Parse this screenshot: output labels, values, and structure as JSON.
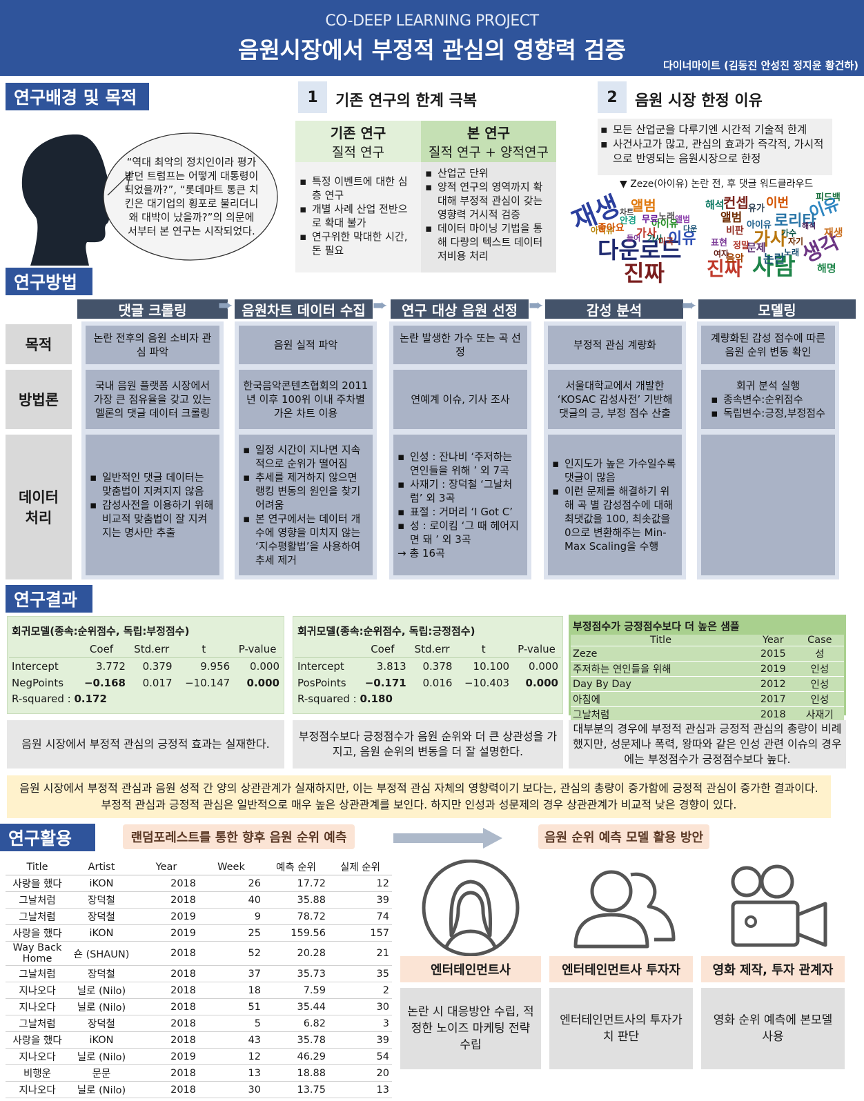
{
  "header": {
    "subtitle": "CO-DEEP LEARNING PROJECT",
    "title": "음원시장에서 부정적 관심의 영향력 검증",
    "authors": "다이너마이트 (김동진 안성진 정지윤 황건하)"
  },
  "background": {
    "section": "연구배경 및 목적",
    "quote": "“역대 최악의 정치인이라 평가받던 트럼프는 어떻게 대통령이 되었을까?”, “롯데마트 통큰 치킨은 대기업의 횡포로 불리더니 왜 대박이 났을까?”의 의문에서부터 본 연구는 시작되었다."
  },
  "limit": {
    "num": "1",
    "title": "기존 연구의 한계 극복",
    "prev_head": "기존 연구",
    "prev_sub": "질적 연구",
    "this_head": "본 연구",
    "this_sub": "질적 연구 + 양적연구",
    "prev_items": [
      "특정 이벤트에 대한 심층 연구",
      "개별 사례 산업 전반으로 확대 불가",
      "연구위한 막대한 시간, 돈 필요"
    ],
    "this_items": [
      "산업군 단위",
      "양적 연구의 영역까지 확대해 부정적 관심이 갖는 영향력 거시적 검증",
      "데이터 마이닝 기법을 통해 다량의 텍스트 데이터 저비용 처리"
    ]
  },
  "reason": {
    "num": "2",
    "title": "음원 시장 한정 이유",
    "items": [
      "모든 산업군을 다루기엔 시간적 기술적 한계",
      "사건사고가 많고, 관심의 효과가 즉각적, 가시적으로 반영되는 음원시장으로 한정"
    ],
    "caption": "▼ Zeze(아이유) 논란 전, 후 댓글 워드클라우드"
  },
  "wordcloud": {
    "before": [
      "재생",
      "다운로드",
      "진짜",
      "앨범",
      "이유",
      "아이유",
      "가사",
      "노래",
      "무료",
      "앨범",
      "안경",
      "아이유",
      "좋아요",
      "가사",
      "미국",
      "차트",
      "다운",
      "들어"
    ],
    "after": [
      "사람",
      "진짜",
      "생각",
      "가사",
      "이유",
      "로리타",
      "컨셉",
      "이번",
      "해석",
      "앨범",
      "재생",
      "아이유",
      "논란",
      "해명",
      "표현",
      "비판",
      "정말",
      "가수",
      "음악",
      "문제",
      "피드백",
      "유가",
      "자기",
      "노래",
      "해석",
      "여자"
    ]
  },
  "method": {
    "section": "연구방법",
    "steps": [
      "댓글 크롤링",
      "음원차트 데이터 수집",
      "연구 대상 음원 선정",
      "감성 분석",
      "모델링"
    ],
    "rows": [
      "목적",
      "방법론",
      "데이터\n처리"
    ],
    "purpose": [
      "논란 전후의 음원 소비자 관심 파악",
      "음원 실적 파악",
      "논란 발생한 가수 또는 곡 선정",
      "부정적 관심 계량화",
      "계량화된 감성 점수에 따른 음원 순위 변동 확인"
    ],
    "methodology": [
      "국내 음원 플랫폼 시장에서 가장 큰 점유율을 갖고 있는 멜론의 댓글 데이터 크롤링",
      "한국음악콘텐츠협회의 2011년 이후 100위 이내 주차별 가온 차트 이용",
      "연예계 이슈, 기사 조사",
      "서울대학교에서 개발한 ‘KOSAC 감성사전’ 기반해 댓글의 긍, 부정 점수 산출"
    ],
    "model_method_head": "회귀 분석 실행",
    "model_method_items": [
      "종속변수:순위점수",
      "독립변수:긍정,부정점수"
    ],
    "data1": [
      "일반적인 댓글 데이터는 맞춤법이 지켜지지 않음",
      "감성사전을 이용하기 위해  비교적 맞춤법이 잘 지켜지는 명사만 추출"
    ],
    "data2": [
      "일정 시간이 지나면 지속적으로 순위가 떨어짐",
      "추세를 제거하지 않으면 랭킹 변동의 원인을 찾기 어려움",
      "본 연구에서는 데이터 개수에 영향을 미치지 않는 ‘지수평활법’을 사용하여 추세 제거"
    ],
    "data3": [
      "인성 : 잔나비 ‘주저하는 연인들을 위해 ’  외 7곡",
      "사재기 : 장덕철 ‘그날처럼’ 외 3곡",
      "표절 : 거머리 ‘I Got C’",
      "성 : 로이킴 ‘그 때 헤어지면 돼 ’  외 3곡"
    ],
    "data3_total": "→ 총 16곡",
    "data4": [
      "인지도가 높은 가수일수록 댓글이 많음",
      "이런 문제를 해결하기 위해 곡 별 감성점수에 대해 최댓값을 100, 최솟값을 0으로 변환해주는 Min-Max Scaling을 수행"
    ]
  },
  "results": {
    "section": "연구결과",
    "reg1": {
      "title": "회귀모델(종속:순위점수, 독립:부정점수)",
      "cols": [
        "",
        "Coef",
        "Std.err",
        "t",
        "P-value"
      ],
      "rows": [
        [
          "Intercept",
          "3.772",
          "0.379",
          "9.956",
          "0.000"
        ],
        [
          "NegPoints",
          "−0.168",
          "0.017",
          "−10.147",
          "0.000"
        ]
      ],
      "r2_label": "R-squared : ",
      "r2": "0.172"
    },
    "reg2": {
      "title": "회귀모델(종속:순위점수, 독립:긍정점수)",
      "cols": [
        "",
        "Coef",
        "Std.err",
        "t",
        "P-value"
      ],
      "rows": [
        [
          "Intercept",
          "3.813",
          "0.378",
          "10.100",
          "0.000"
        ],
        [
          "PosPoints",
          "−0.171",
          "0.016",
          "−10.403",
          "0.000"
        ]
      ],
      "r2_label": "R-squared : ",
      "r2": "0.180"
    },
    "sample": {
      "title": "부정점수가 긍정점수보다 더 높은 샘플",
      "cols": [
        "Title",
        "Year",
        "Case"
      ],
      "rows": [
        [
          "Zeze",
          "2015",
          "성"
        ],
        [
          "주저하는 연인들을 위해",
          "2019",
          "인성"
        ],
        [
          "Day By Day",
          "2012",
          "인성"
        ],
        [
          "아침에",
          "2017",
          "인성"
        ],
        [
          "그날처럼",
          "2018",
          "사재기"
        ]
      ]
    },
    "note1": "음원 시장에서 부정적 관심의 긍정적 효과는 실재한다.",
    "note2": "부정점수보다 긍정점수가 음원 순위와 더 큰 상관성을 가지고, 음원 순위의 변동을 더 잘 설명한다.",
    "note3": "대부분의 경우에 부정적 관심과 긍정적 관심의 총량이 비례했지만, 성문제나 폭력, 왕따와 같은 인성 관련 이슈의 경우에는 부정점수가 긍정점수보다 높다.",
    "conclusion": "음원 시장에서 부정적 관심과 음원 성적 간 양의 상관관계가 실재하지만, 이는 부정적 관심 자체의 영향력이기 보다는, 관심의 총량이 증가함에 긍정적 관심이 증가한 결과이다. 부정적 관심과 긍정적 관심은 일반적으로 매우 높은 상관관계를 보인다. 하지만 인성과 성문제의 경우 상관관계가 비교적 낮은 경향이 있다."
  },
  "usage": {
    "section": "연구활용",
    "pill1": "랜덤포레스트를 통한 향후 음원 순위 예측",
    "pill2": "음원 순위 예측 모델 활용 방안",
    "pred_cols": [
      "Title",
      "Artist",
      "Year",
      "Week",
      "예측 순위",
      "실제 순위"
    ],
    "pred_rows": [
      [
        "사랑을 했다",
        "iKON",
        "2018",
        "26",
        "17.72",
        "12"
      ],
      [
        "그날처럼",
        "장덕철",
        "2018",
        "40",
        "35.88",
        "39"
      ],
      [
        "그날처럼",
        "장덕철",
        "2019",
        "9",
        "78.72",
        "74"
      ],
      [
        "사랑을 했다",
        "iKON",
        "2019",
        "25",
        "159.56",
        "157"
      ],
      [
        "Way Back Home",
        "숀 (SHAUN)",
        "2018",
        "52",
        "20.28",
        "21"
      ],
      [
        "그날처럼",
        "장덕철",
        "2018",
        "37",
        "35.73",
        "35"
      ],
      [
        "지나오다",
        "닐로 (Nilo)",
        "2018",
        "18",
        "7.59",
        "2"
      ],
      [
        "지나오다",
        "닐로 (Nilo)",
        "2018",
        "51",
        "35.44",
        "30"
      ],
      [
        "그날처럼",
        "장덕철",
        "2018",
        "5",
        "6.82",
        "3"
      ],
      [
        "사랑을 했다",
        "iKON",
        "2018",
        "43",
        "35.78",
        "39"
      ],
      [
        "지나오다",
        "닐로 (Nilo)",
        "2019",
        "12",
        "46.29",
        "54"
      ],
      [
        "비행운",
        "문문",
        "2018",
        "13",
        "18.88",
        "20"
      ],
      [
        "지나오다",
        "닐로 (Nilo)",
        "2018",
        "30",
        "13.75",
        "13"
      ]
    ],
    "uses": [
      {
        "label": "엔터테인먼트사",
        "desc": "논란 시 대응방안 수립, 적정한 노이즈 마케팅 전략 수립"
      },
      {
        "label": "엔터테인먼트사 투자자",
        "desc": "엔터테인먼트사의 투자가치 판단"
      },
      {
        "label": "영화 제작, 투자 관계자",
        "desc": "영화 순위 예측에 본모델 사용"
      }
    ]
  }
}
